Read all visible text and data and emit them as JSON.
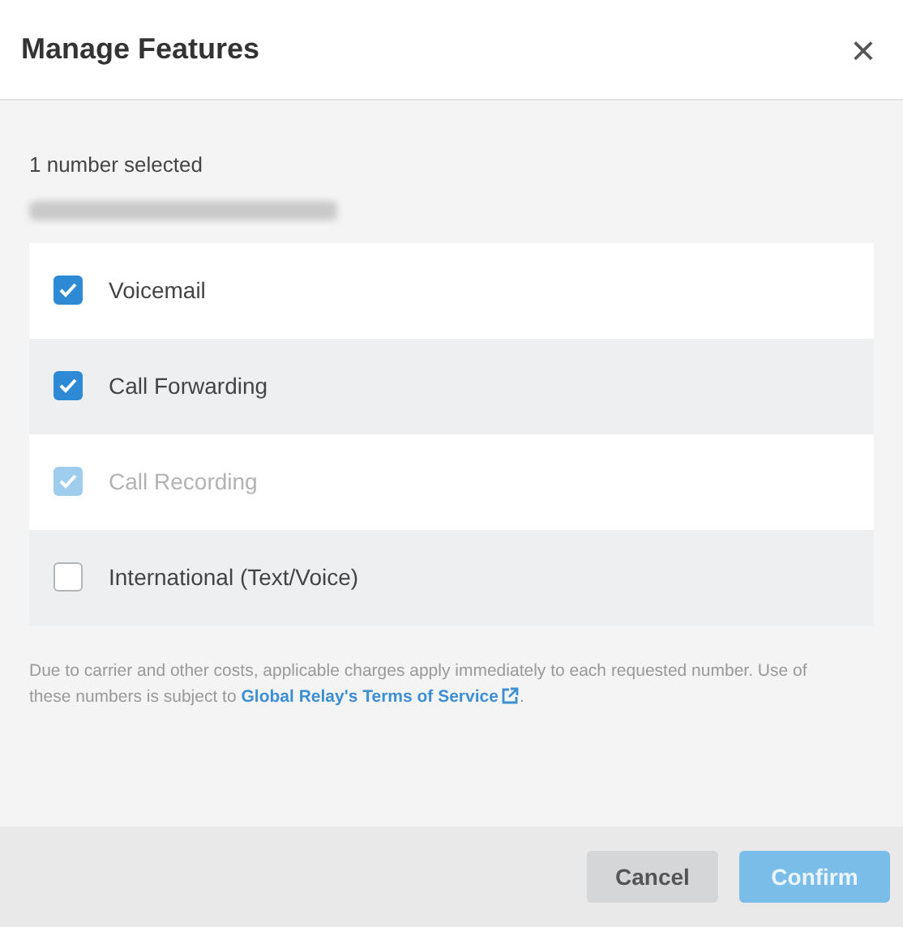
{
  "dialog": {
    "title": "Manage Features",
    "close_label": "×"
  },
  "selection_summary": "1 number selected",
  "features": [
    {
      "label": "Voicemail",
      "checked": true,
      "disabled": false
    },
    {
      "label": "Call Forwarding",
      "checked": true,
      "disabled": false
    },
    {
      "label": "Call Recording",
      "checked": true,
      "disabled": true
    },
    {
      "label": "International (Text/Voice)",
      "checked": false,
      "disabled": false
    }
  ],
  "notice": {
    "text": "Due to carrier and other costs, applicable charges apply immediately to each requested number. Use of these numbers is subject to ",
    "link": "Global Relay's Terms of Service",
    "after": "."
  },
  "buttons": [
    {
      "label": "Cancel",
      "kind": "secondary",
      "disabled": false
    },
    {
      "label": "Confirm",
      "kind": "primary",
      "disabled": true
    }
  ]
}
